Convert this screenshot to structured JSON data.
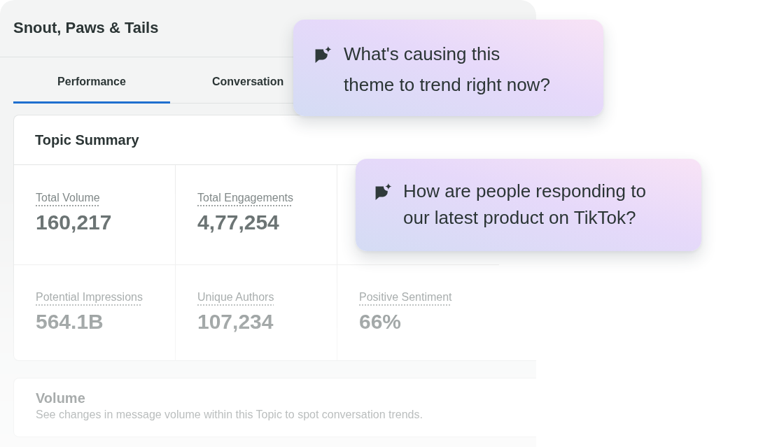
{
  "header": {
    "title": "Snout, Paws & Tails"
  },
  "tabs": [
    {
      "label": "Performance",
      "selected": true
    },
    {
      "label": "Conversation",
      "selected": false
    }
  ],
  "topic_summary": {
    "title": "Topic Summary",
    "metric_rows": [
      [
        {
          "label": "Total Volume",
          "value": "160,217"
        },
        {
          "label": "Total Engagements",
          "value": "4,77,254"
        }
      ],
      [
        {
          "label": "Potential Impressions",
          "value": "564.1B"
        },
        {
          "label": "Unique Authors",
          "value": "107,234"
        },
        {
          "label": "Positive Sentiment",
          "value": "66%"
        }
      ]
    ]
  },
  "volume": {
    "title": "Volume",
    "description": "See changes in message volume within this Topic to spot conversation trends."
  },
  "suggestions": [
    {
      "text": "What's causing this\ntheme to trend right now?"
    },
    {
      "text": "How are people responding to\nour latest product on TikTok?"
    }
  ]
}
